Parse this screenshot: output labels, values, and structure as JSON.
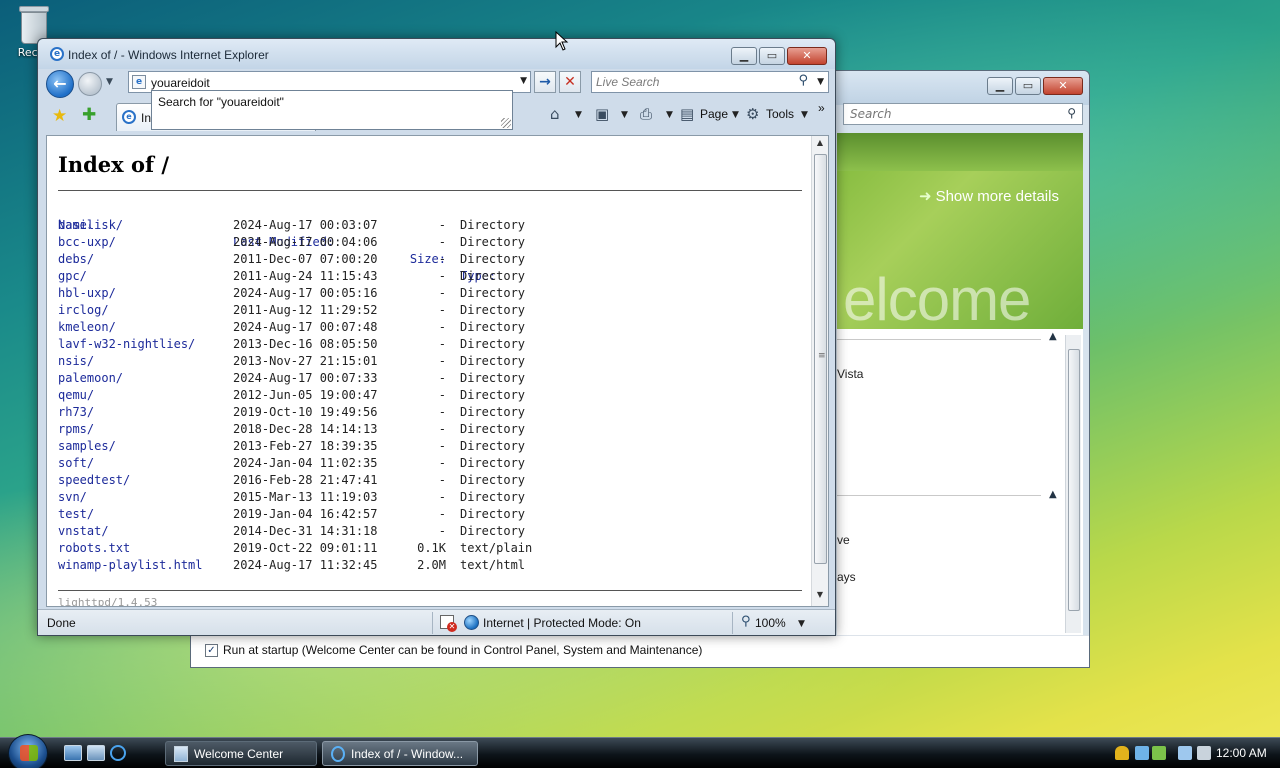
{
  "desktop": {
    "recycle_bin_label": "Recyc"
  },
  "welcome_center": {
    "search_placeholder": "Search",
    "show_more": "Show more details",
    "banner_word": "elcome",
    "fragments": [
      "Vista",
      "ve",
      "ays"
    ],
    "startup_label": "Run at startup (Welcome Center can be found in Control Panel, System and Maintenance)",
    "startup_checked": true
  },
  "ie": {
    "title": "Index of / - Windows Internet Explorer",
    "address": "youareidoit",
    "suggestion": "Search for \"youareidoit\"",
    "live_search_placeholder": "Live Search",
    "tab_label": "In",
    "page_menu": "Page",
    "tools_menu": "Tools",
    "chevron": "»",
    "status_text": "Done",
    "zone_text": "Internet | Protected Mode: On",
    "zoom": "100%"
  },
  "listing": {
    "heading": "Index of /",
    "columns": {
      "name": "Name",
      "sort_marker": "↓",
      "modified": "Last Modified:",
      "size": "Size:",
      "type": "Type:"
    },
    "rows": [
      {
        "name": "basilisk/",
        "modified": "2024-Aug-17 00:03:07",
        "size": "-",
        "type": "Directory"
      },
      {
        "name": "bcc-uxp/",
        "modified": "2024-Aug-17 00:04:06",
        "size": "-",
        "type": "Directory"
      },
      {
        "name": "debs/",
        "modified": "2011-Dec-07 07:00:20",
        "size": "-",
        "type": "Directory"
      },
      {
        "name": "gpc/",
        "modified": "2011-Aug-24 11:15:43",
        "size": "-",
        "type": "Directory"
      },
      {
        "name": "hbl-uxp/",
        "modified": "2024-Aug-17 00:05:16",
        "size": "-",
        "type": "Directory"
      },
      {
        "name": "irclog/",
        "modified": "2011-Aug-12 11:29:52",
        "size": "-",
        "type": "Directory"
      },
      {
        "name": "kmeleon/",
        "modified": "2024-Aug-17 00:07:48",
        "size": "-",
        "type": "Directory"
      },
      {
        "name": "lavf-w32-nightlies/",
        "modified": "2013-Dec-16 08:05:50",
        "size": "-",
        "type": "Directory"
      },
      {
        "name": "nsis/",
        "modified": "2013-Nov-27 21:15:01",
        "size": "-",
        "type": "Directory"
      },
      {
        "name": "palemoon/",
        "modified": "2024-Aug-17 00:07:33",
        "size": "-",
        "type": "Directory"
      },
      {
        "name": "qemu/",
        "modified": "2012-Jun-05 19:00:47",
        "size": "-",
        "type": "Directory"
      },
      {
        "name": "rh73/",
        "modified": "2019-Oct-10 19:49:56",
        "size": "-",
        "type": "Directory"
      },
      {
        "name": "rpms/",
        "modified": "2018-Dec-28 14:14:13",
        "size": "-",
        "type": "Directory"
      },
      {
        "name": "samples/",
        "modified": "2013-Feb-27 18:39:35",
        "size": "-",
        "type": "Directory"
      },
      {
        "name": "soft/",
        "modified": "2024-Jan-04 11:02:35",
        "size": "-",
        "type": "Directory"
      },
      {
        "name": "speedtest/",
        "modified": "2016-Feb-28 21:47:41",
        "size": "-",
        "type": "Directory"
      },
      {
        "name": "svn/",
        "modified": "2015-Mar-13 11:19:03",
        "size": "-",
        "type": "Directory"
      },
      {
        "name": "test/",
        "modified": "2019-Jan-04 16:42:57",
        "size": "-",
        "type": "Directory"
      },
      {
        "name": "vnstat/",
        "modified": "2014-Dec-31 14:31:18",
        "size": "-",
        "type": "Directory"
      },
      {
        "name": "robots.txt",
        "modified": "2019-Oct-22 09:01:11",
        "size": "0.1K",
        "type": "text/plain"
      },
      {
        "name": "winamp-playlist.html",
        "modified": "2024-Aug-17 11:32:45",
        "size": "2.0M",
        "type": "text/html"
      }
    ],
    "footer": "lighttpd/1.4.53"
  },
  "taskbar": {
    "buttons": [
      {
        "label": "Welcome Center"
      },
      {
        "label": "Index of / - Window..."
      }
    ],
    "clock": "12:00 AM"
  }
}
